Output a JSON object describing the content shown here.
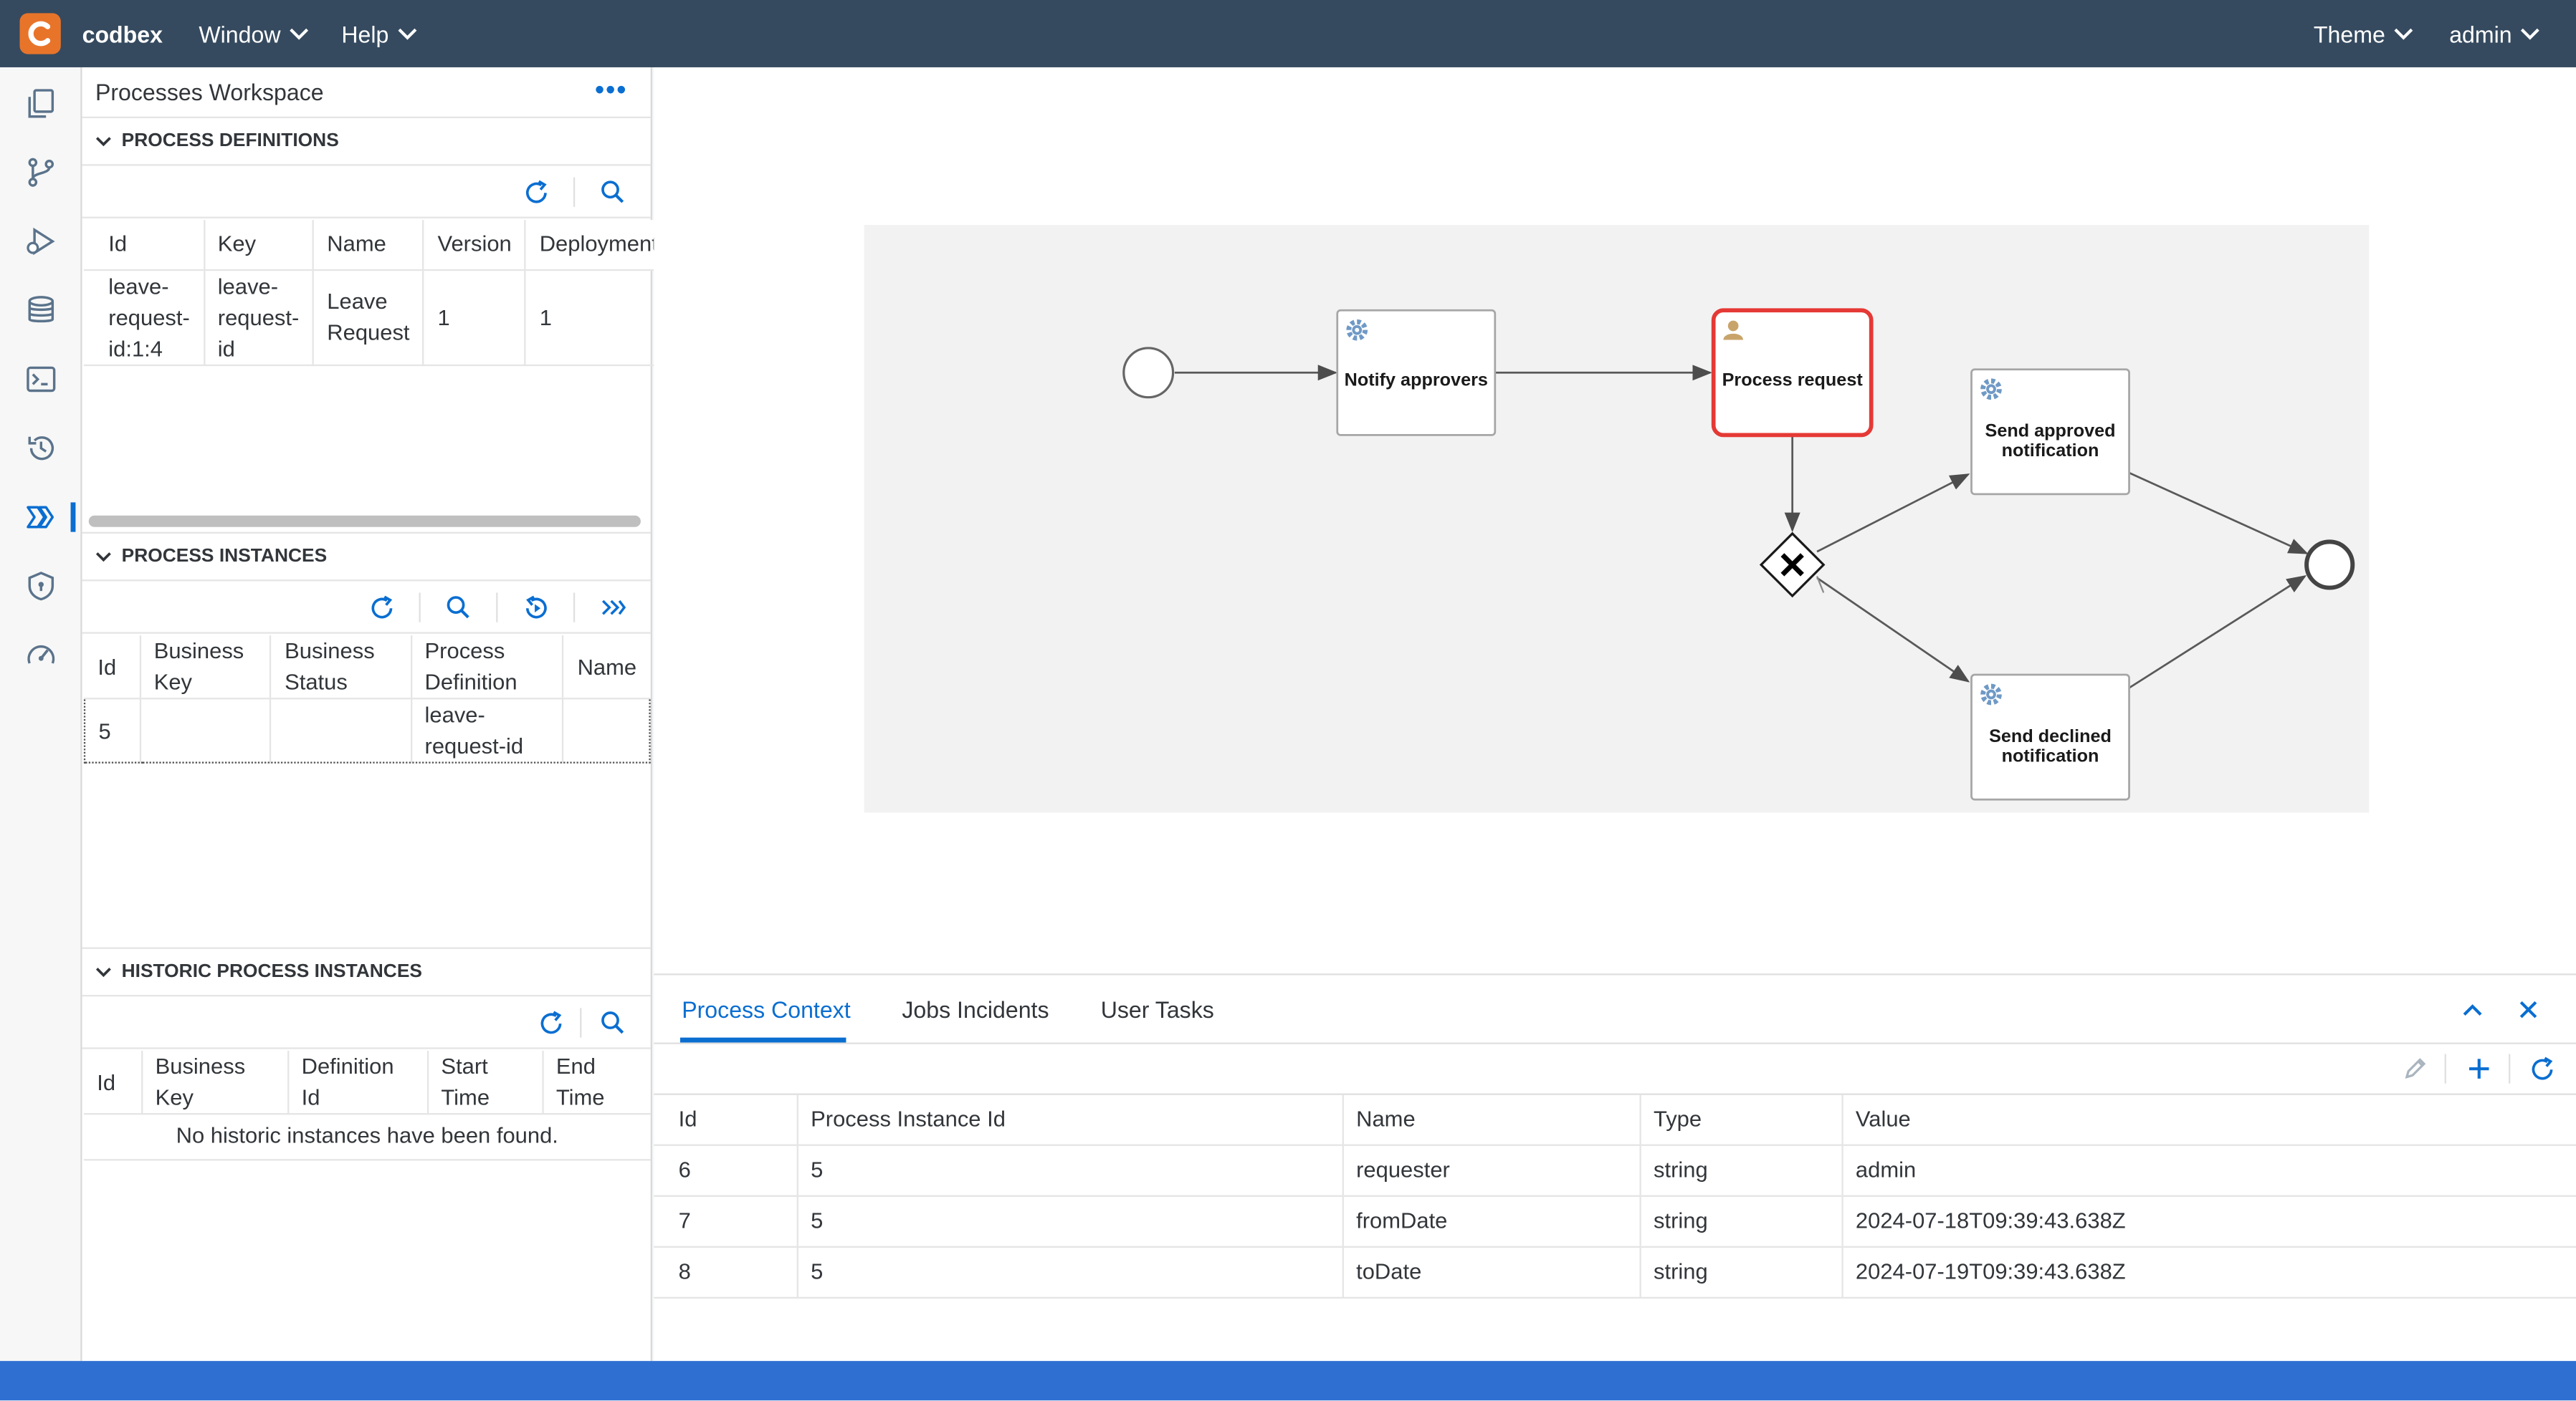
{
  "app": {
    "brand": "codbex",
    "menus": [
      "Window",
      "Help"
    ],
    "right_menus": [
      "Theme",
      "admin"
    ]
  },
  "sidebar_icons": [
    "documents-icon",
    "git-branch-icon",
    "debug-icon",
    "database-icon",
    "terminal-icon",
    "history-icon",
    "processes-icon",
    "shield-icon",
    "dashboard-icon"
  ],
  "workspace": {
    "title": "Processes Workspace",
    "more": "•••"
  },
  "definitions": {
    "title": "PROCESS DEFINITIONS",
    "columns": [
      "Id",
      "Key",
      "Name",
      "Version",
      "Deployment"
    ],
    "rows": [
      {
        "id": [
          "leave-",
          "request-",
          "id:1:4"
        ],
        "key": [
          "leave-",
          "request-",
          "id"
        ],
        "name": [
          "Leave",
          "Request"
        ],
        "version": "1",
        "deployment": "1"
      }
    ]
  },
  "instances": {
    "title": "PROCESS INSTANCES",
    "columns": [
      [
        "Id"
      ],
      [
        "Business",
        "Key"
      ],
      [
        "Business",
        "Status"
      ],
      [
        "Process",
        "Definition"
      ],
      [
        "Name"
      ]
    ],
    "rows": [
      {
        "id": "5",
        "business_key": "",
        "business_status": "",
        "definition": [
          "leave-",
          "request-id"
        ],
        "name": ""
      }
    ]
  },
  "historic": {
    "title": "HISTORIC PROCESS INSTANCES",
    "columns": [
      [
        "Id"
      ],
      [
        "Business",
        "Key"
      ],
      [
        "Definition",
        "Id"
      ],
      [
        "Start",
        "Time"
      ],
      [
        "End",
        "Time"
      ]
    ],
    "empty": "No historic instances have been found."
  },
  "diagram": {
    "tasks": {
      "notify": "Notify approvers",
      "process": "Process request",
      "approved": [
        "Send approved",
        "notification"
      ],
      "declined": [
        "Send declined",
        "notification"
      ]
    },
    "colors": {
      "active": "#e53935",
      "gear": "#6f99c6",
      "user": "#c9a46a"
    }
  },
  "bottom": {
    "tabs": [
      "Process Context",
      "Jobs Incidents",
      "User Tasks"
    ],
    "columns": [
      "Id",
      "Process Instance Id",
      "Name",
      "Type",
      "Value"
    ],
    "rows": [
      {
        "id": "6",
        "pid": "5",
        "name": "requester",
        "type": "string",
        "value": "admin"
      },
      {
        "id": "7",
        "pid": "5",
        "name": "fromDate",
        "type": "string",
        "value": "2024-07-18T09:39:43.638Z"
      },
      {
        "id": "8",
        "pid": "5",
        "name": "toDate",
        "type": "string",
        "value": "2024-07-19T09:39:43.638Z"
      }
    ]
  }
}
